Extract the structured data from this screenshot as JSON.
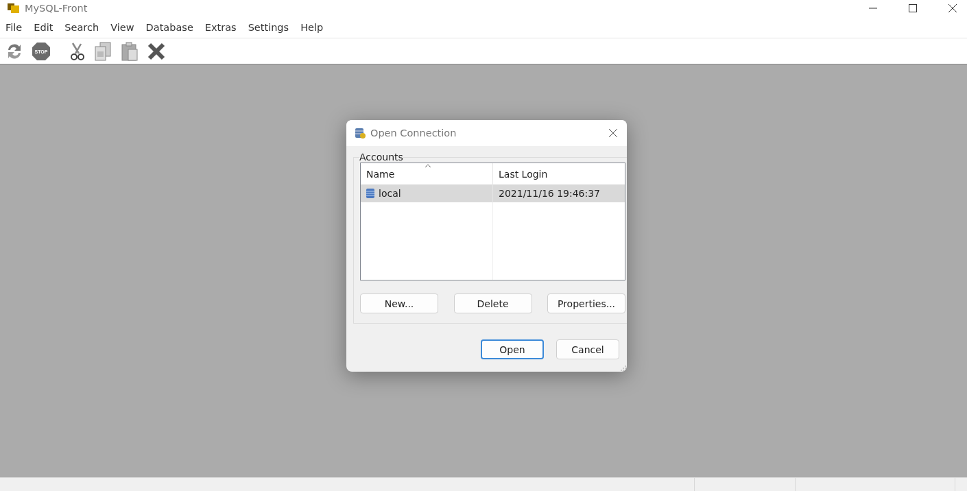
{
  "window": {
    "title": "MySQL-Front"
  },
  "menu": [
    "File",
    "Edit",
    "Search",
    "View",
    "Database",
    "Extras",
    "Settings",
    "Help"
  ],
  "toolbar": [
    {
      "kind": "refresh"
    },
    {
      "kind": "stop",
      "label": "STOP"
    },
    {
      "kind": "cut"
    },
    {
      "kind": "copy"
    },
    {
      "kind": "paste"
    },
    {
      "kind": "delete"
    }
  ],
  "dialog": {
    "title": "Open Connection",
    "group": "Accounts",
    "columns": [
      {
        "label": "Name",
        "sorted": true
      },
      {
        "label": "Last Login",
        "sorted": false
      }
    ],
    "rows": [
      {
        "name": "local",
        "last_login": "2021/11/16 19:46:37",
        "selected": true
      }
    ],
    "account_buttons": [
      "New...",
      "Delete",
      "Properties..."
    ],
    "buttons": [
      {
        "label": "Open",
        "default": true
      },
      {
        "label": "Cancel",
        "default": false
      }
    ]
  }
}
